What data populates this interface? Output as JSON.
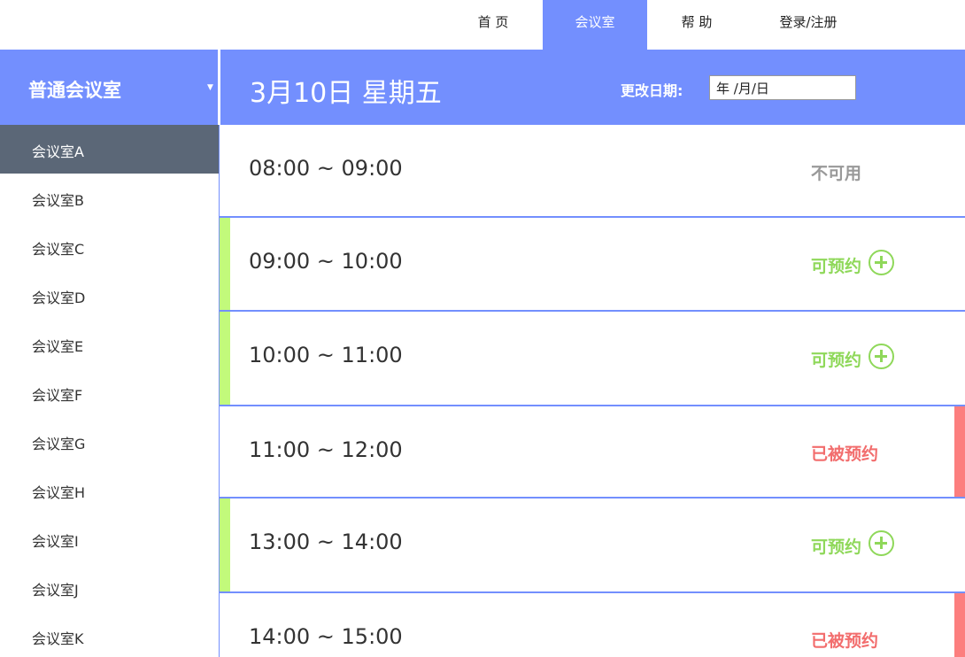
{
  "nav": {
    "items": [
      {
        "label": "首 页"
      },
      {
        "label": "会议室"
      },
      {
        "label": "帮 助"
      },
      {
        "label": "登录/注册"
      }
    ]
  },
  "header": {
    "room_type": "普通会议室",
    "date_title": "3月10日 星期五",
    "change_date_label": "更改日期:",
    "date_input_value": "年 /月/日"
  },
  "sidebar": {
    "rooms": [
      {
        "label": "会议室A"
      },
      {
        "label": "会议室B"
      },
      {
        "label": "会议室C"
      },
      {
        "label": "会议室D"
      },
      {
        "label": "会议室E"
      },
      {
        "label": "会议室F"
      },
      {
        "label": "会议室G"
      },
      {
        "label": "会议室H"
      },
      {
        "label": "会议室I"
      },
      {
        "label": "会议室J"
      },
      {
        "label": "会议室K"
      }
    ]
  },
  "slots": [
    {
      "time": "08:00 ~ 09:00",
      "status": "不可用"
    },
    {
      "time": "09:00 ~ 10:00",
      "status": "可预约"
    },
    {
      "time": "10:00 ~ 11:00",
      "status": "可预约"
    },
    {
      "time": "11:00 ~ 12:00",
      "status": "已被预约"
    },
    {
      "time": "13:00 ~ 14:00",
      "status": "可预约"
    },
    {
      "time": "14:00 ~ 15:00",
      "status": "已被预约"
    }
  ],
  "colors": {
    "accent": "#738ffe",
    "sidebar_active": "#5b6777",
    "available": "#8fd85a",
    "available_bar": "#c2fa7b",
    "booked": "#f26d6d",
    "booked_bar": "#fc7e7e",
    "unavailable": "#999999"
  }
}
